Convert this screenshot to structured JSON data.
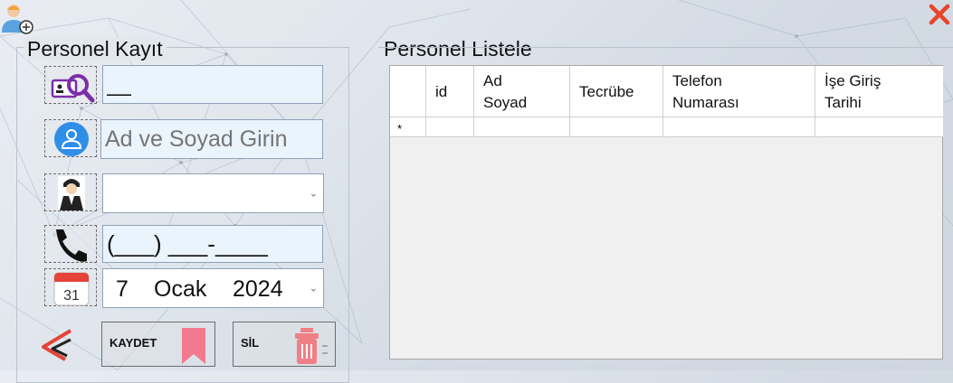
{
  "personel_kayit": {
    "title": "Personel Kayıt",
    "id_field_value": "__",
    "name_field_placeholder": "Ad ve Soyad Girin",
    "experience_select_value": "",
    "phone_field_value": "(___) ___-____",
    "date_picker": {
      "day": "7",
      "month": "Ocak",
      "year": "2024"
    },
    "calendar_icon_day": "31",
    "save_button_label": "KAYDET",
    "delete_button_label": "SİL"
  },
  "personel_listele": {
    "title": "Personel Listele",
    "columns": [
      "id",
      "Ad Soyad",
      "Tecrübe",
      "Telefon Numarası",
      "İşe Giriş Tarihi"
    ],
    "column_lines": [
      [
        "id"
      ],
      [
        "Ad",
        "Soyad"
      ],
      [
        "Tecrübe"
      ],
      [
        "Telefon",
        "Numarası"
      ],
      [
        "İşe Giriş",
        "Tarihi"
      ]
    ],
    "new_row_marker": "*"
  },
  "colors": {
    "close": "#e8432b",
    "field_bg": "#eaf4fd",
    "save_bookmark": "#f27a8f",
    "delete_bin": "#f07f86",
    "search_icon": "#7b2ea8"
  },
  "icons": [
    "user-add-icon",
    "close-icon",
    "id-search-icon",
    "person-icon",
    "worker-avatar-icon",
    "phone-icon",
    "calendar-icon",
    "back-arrow-icon",
    "bookmark-icon",
    "trash-icon"
  ]
}
